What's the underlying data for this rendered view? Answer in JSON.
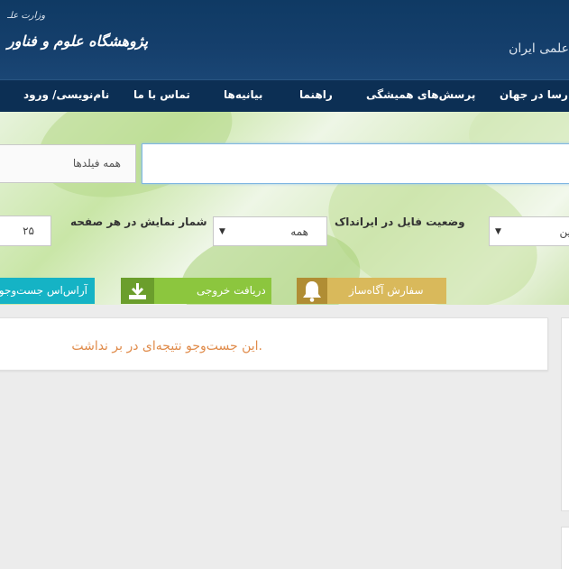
{
  "header": {
    "ministry_text": "وزارت علـ",
    "institute_text": "پژوهشگاه علوم و فناور",
    "site_title": "علمی ایران"
  },
  "nav": {
    "items": [
      {
        "label": "نام‌نویسی/ ورود"
      },
      {
        "label": "تماس با ما"
      },
      {
        "label": "بیانیه‌ها"
      },
      {
        "label": "راهنما"
      },
      {
        "label": "پرسش‌های همیشگی"
      },
      {
        "label": "پارسا در جهان"
      }
    ]
  },
  "search": {
    "field_select_value": "همه فیلدها",
    "query_value": ""
  },
  "filters": {
    "per_page_label": "شمار نمایش در هر صفحه",
    "per_page_value": "۲۵",
    "file_status_label": "وضعیت فایل در ایرانداک",
    "file_status_value": "همه",
    "third_value": "ین"
  },
  "actions": {
    "reset_label": "آراس‌اس جست‌وجو",
    "export_label": "دریافت خروجی",
    "alert_label": "سفارش آگاه‌ساز"
  },
  "results": {
    "empty_message": "این جست‌وجو نتیجه‌ای در بر نداشت."
  },
  "colors": {
    "header_bg": "#0f3a64",
    "nav_bg": "#0c2f54",
    "reset_button": "#15b3c5",
    "export_button": "#8cc63e",
    "alert_button": "#d9b95b",
    "empty_message": "#e08b4a"
  }
}
